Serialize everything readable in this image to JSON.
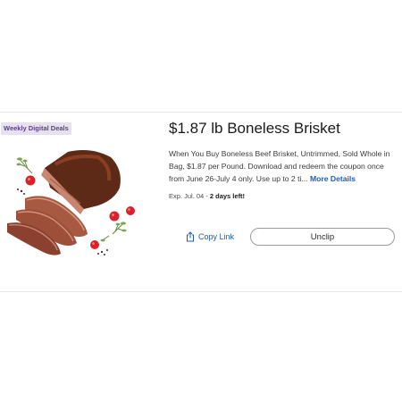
{
  "deal": {
    "badge": "Weekly Digital Deals",
    "title": "$1.87 lb Boneless Brisket",
    "description": "When You Buy Boneless Beef Brisket, Untrimmed, Sold Whole in Bag, $1.87 per Pound. Download and redeem the coupon once from June 26-July 4 only. Use up to 2 ti...",
    "more_details_label": "More Details",
    "expiry_label": "Exp. Jul. 04 -",
    "days_left": "2 days left!",
    "image_icon": "sliced-brisket-photo"
  },
  "actions": {
    "copy_link_label": "Copy Link",
    "copy_link_icon": "share-icon",
    "unclip_label": "Unclip"
  },
  "colors": {
    "badge_bg": "#e7e1ef",
    "badge_text": "#5b3f85",
    "link": "#1f5cb5"
  }
}
